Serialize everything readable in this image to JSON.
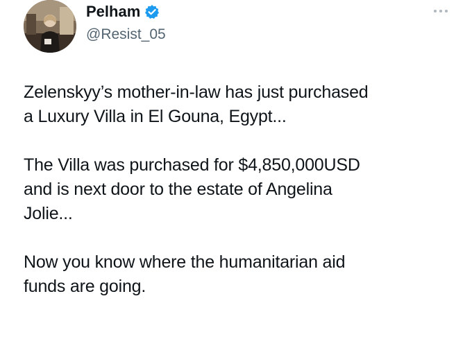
{
  "author": {
    "display_name": "Pelham",
    "handle": "@Resist_05",
    "verified": true,
    "avatar_icon": "profile-photo"
  },
  "menu": {
    "icon": "more-horizontal-icon"
  },
  "tweet": {
    "paragraphs": [
      "Zelenskyy’s mother-in-law has just purchased\na Luxury Villa in El Gouna, Egypt...",
      "The Villa was purchased for $4,850,000USD\nand is next door to the estate of Angelina\nJolie...",
      "Now you know where the humanitarian aid\nfunds are going."
    ]
  },
  "colors": {
    "text": "#0f1419",
    "secondary": "#536471",
    "verified": "#1d9bf0"
  }
}
